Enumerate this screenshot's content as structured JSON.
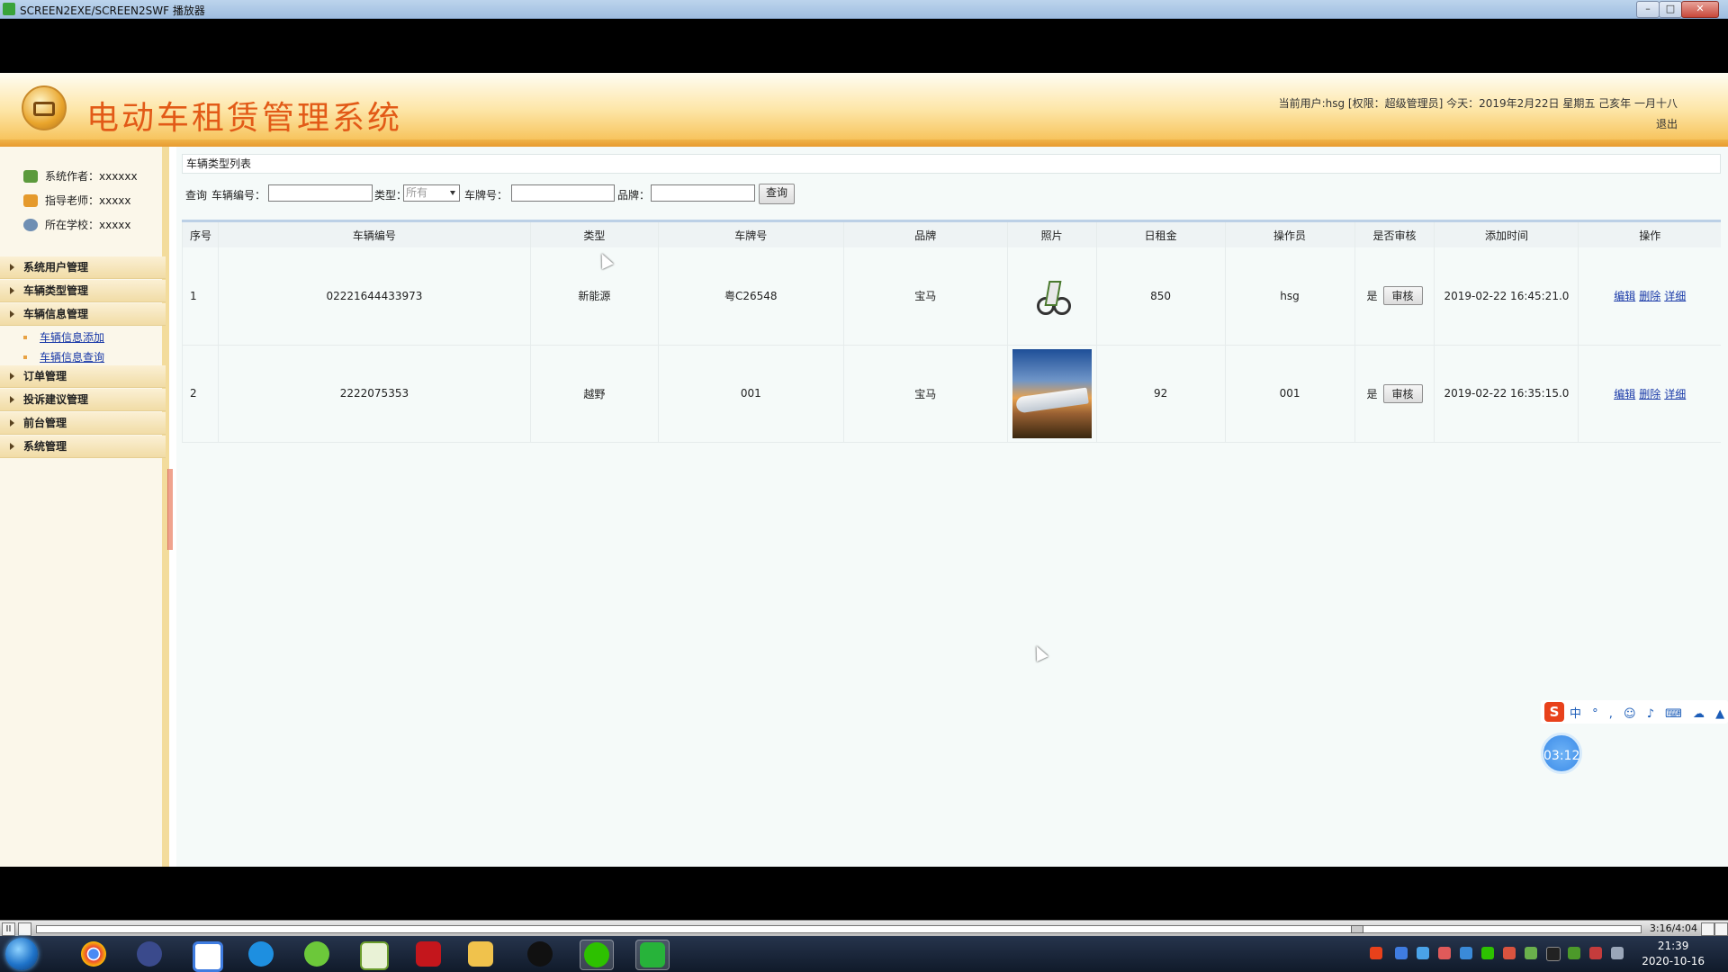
{
  "window": {
    "title": "SCREEN2EXE/SCREEN2SWF 播放器",
    "minimize": "–",
    "maximize": "□",
    "close": "✕"
  },
  "header": {
    "site_title": "电动车租赁管理系统",
    "user_info": "当前用户:hsg [权限：超级管理员] 今天：2019年2月22日 星期五 己亥年 一月十八",
    "logout": "退出"
  },
  "sidebar": {
    "info": [
      {
        "label": "系统作者：xxxxxx",
        "icon": "user-icon"
      },
      {
        "label": "指导老师：xxxxx",
        "icon": "teacher-icon"
      },
      {
        "label": "所在学校：xxxxx",
        "icon": "school-icon"
      }
    ],
    "menus": [
      {
        "label": "系统用户管理"
      },
      {
        "label": "车辆类型管理"
      },
      {
        "label": "车辆信息管理",
        "children": [
          "车辆信息添加",
          "车辆信息查询"
        ]
      },
      {
        "label": "订单管理"
      },
      {
        "label": "投诉建议管理"
      },
      {
        "label": "前台管理"
      },
      {
        "label": "系统管理"
      }
    ]
  },
  "content": {
    "title": "车辆类型列表",
    "search": {
      "prefix": "查询",
      "vehicle_no_label": "车辆编号：",
      "type_label": "类型：",
      "type_selected": "所有",
      "plate_label": "车牌号：",
      "brand_label": "品牌：",
      "button": "查询"
    },
    "table": {
      "headers": [
        "序号",
        "车辆编号",
        "类型",
        "车牌号",
        "品牌",
        "照片",
        "日租金",
        "操作员",
        "是否审核",
        "添加时间",
        "操作"
      ],
      "rows": [
        {
          "index": "1",
          "vehicle_no": "02221644433973",
          "type": "新能源",
          "plate": "粤C26548",
          "brand": "宝马",
          "photo": "bike",
          "rent": "850",
          "operator": "hsg",
          "audited": "是",
          "audit_btn": "审核",
          "added": "2019-02-22 16:45:21.0",
          "actions": [
            "编辑",
            "删除",
            "详细"
          ]
        },
        {
          "index": "2",
          "vehicle_no": "2222075353",
          "type": "越野",
          "plate": "001",
          "brand": "宝马",
          "photo": "train",
          "rent": "92",
          "operator": "001",
          "audited": "是",
          "audit_btn": "审核",
          "added": "2019-02-22 16:35:15.0",
          "actions": [
            "编辑",
            "删除",
            "详细"
          ]
        }
      ]
    }
  },
  "ime": {
    "logo": "S",
    "items": "中 ° , ☺ ♪ ⌨ ☁ ▲ ▦"
  },
  "timer": "03:12",
  "player": {
    "pause": "II",
    "time": "3:16/4:04",
    "progress": 0.82
  },
  "taskbar": {
    "clock_time": "21:39",
    "clock_date": "2020-10-16",
    "apps": [
      "chrome",
      "media-player",
      "picture",
      "browser-q",
      "green-app",
      "chart-app",
      "flash",
      "file-explorer",
      "qq",
      "wechat",
      "screen-player"
    ]
  },
  "colors": {
    "title_text": "#e25a17",
    "link": "#1a3aa8",
    "header_band": "#f7c45e"
  }
}
